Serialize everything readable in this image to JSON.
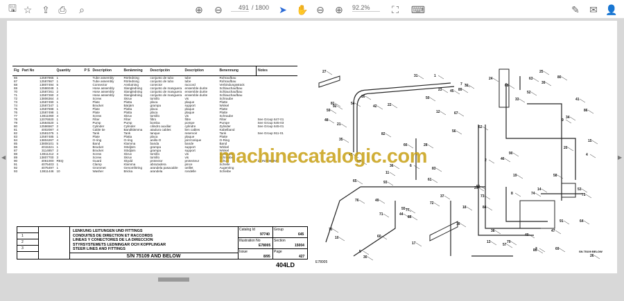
{
  "toolbar": {
    "page_current": "491",
    "page_total": "/ 1800",
    "zoom": "92.2%",
    "icons": [
      "save-icon",
      "bookmark-star-icon",
      "upload-icon",
      "print-icon",
      "search-icon",
      "page-up-icon",
      "page-down-icon",
      "select-cursor-icon",
      "hand-icon",
      "zoom-out-icon",
      "zoom-in-icon",
      "fit-page-icon",
      "read-mode-icon",
      "sign-icon",
      "mail-icon",
      "add-user-icon"
    ]
  },
  "colors": {
    "watermark": "#c8a014",
    "cursor": "#2a6ad6"
  },
  "table": {
    "headers": {
      "fig": "Fig",
      "part": "Part No",
      "qty": "Quantity",
      "q1": "1",
      "q2": "2",
      "q3": "3",
      "ps": "P S",
      "s": "S I",
      "desc": "Description",
      "sv": "Benämning",
      "es": "Descripción",
      "fr": "Description",
      "de": "Benennung",
      "notes": "Notes"
    },
    "rows": [
      [
        "65",
        "12587865",
        "1",
        "Tube assembly",
        "Rörledning",
        "conjunto de tubo",
        "tube",
        "Rohraufbau",
        ""
      ],
      [
        "67",
        "12587867",
        "1",
        "Tube assembly",
        "Rörledning",
        "conjunto de tubo",
        "tube",
        "Rohraufbau",
        ""
      ],
      [
        "68",
        "13807494",
        "5",
        "Connector",
        "Anslutning",
        "conector",
        "raccord",
        "Verbindungsstück",
        ""
      ],
      [
        "69",
        "12586048",
        "1",
        "Hose assembly",
        "Slangledning",
        "conjunto de manguera",
        "ensemble durite",
        "Schlauchaufbau",
        ""
      ],
      [
        "70",
        "12587261",
        "2",
        "Hose assembly",
        "Slangledning",
        "conjunto de manguera",
        "ensemble durite",
        "Schlauchaufbau",
        ""
      ],
      [
        "71",
        "12587260",
        "2",
        "Hose assembly",
        "Slangledning",
        "conjunto de manguera",
        "ensemble durite",
        "Schlauchaufbau",
        ""
      ],
      [
        "72",
        "13806364",
        "4",
        "Screw",
        "Skruv",
        "tornillo",
        "vis",
        "Schraube",
        ""
      ],
      [
        "73",
        "12587490",
        "1",
        "Plate",
        "Platta",
        "placa",
        "plaque",
        "Platte",
        ""
      ],
      [
        "74",
        "12587347",
        "1",
        "Bracket",
        "Bärjärn",
        "grampa",
        "support",
        "Winkel",
        ""
      ],
      [
        "75",
        "12587698",
        "1",
        "Plate",
        "Platta",
        "placa",
        "plaque",
        "Platte",
        ""
      ],
      [
        "76",
        "12587498",
        "1",
        "Plate",
        "Platta",
        "placa",
        "plaque",
        "Platte",
        ""
      ],
      [
        "77",
        "13811060",
        "4",
        "Screw",
        "Skruv",
        "tornillo",
        "vis",
        "Schraube",
        ""
      ],
      [
        "78",
        "12076920",
        "1",
        "Filter",
        "Filter",
        "filtro",
        "filtre",
        "Filter",
        "See Group 647-01"
      ],
      [
        "79",
        "12584520",
        "1",
        "Pump",
        "Pump",
        "bomba",
        "pompe",
        "Pumpe",
        "See Group 645-03"
      ],
      [
        "80",
        "12586567",
        "2",
        "Cylinder",
        "Cylinder",
        "cilindro auxiliar",
        "cylindre",
        "Zylinder",
        "See Group 645-01"
      ],
      [
        "81",
        "4002087",
        "4",
        "Cable tie",
        "Bandklämma",
        "atadura cables",
        "lien cables",
        "Kabelband",
        ""
      ],
      [
        "82",
        "12581075",
        "1",
        "Tank",
        "Tank",
        "tanque",
        "reservoir",
        "Tank",
        "See Group 911-01"
      ],
      [
        "83",
        "12587485",
        "1",
        "Plate",
        "Platta",
        "placa",
        "plaque",
        "Platte",
        ""
      ],
      [
        "84",
        "13804267",
        "4",
        "O-ring",
        "O-ring",
        "anillo-O",
        "joint torique",
        "O-Ring",
        ""
      ],
      [
        "85",
        "13808101",
        "5",
        "Band",
        "Klamma",
        "banda",
        "bande",
        "Band",
        ""
      ],
      [
        "86",
        "4015321",
        "1",
        "Bracket",
        "Stödjärn",
        "grampa",
        "support",
        "Winkel",
        ""
      ],
      [
        "87",
        "3114857",
        "2",
        "Bracket",
        "Stödjärn",
        "grampa",
        "support",
        "Winkel",
        ""
      ],
      [
        "88",
        "13811212",
        "3",
        "Screw",
        "Skruv",
        "tornillo",
        "vis",
        "Schraube",
        ""
      ],
      [
        "89",
        "13807700",
        "3",
        "Screw",
        "Skruv",
        "tornillo",
        "vis",
        "Schraube",
        ""
      ],
      [
        "90",
        "4061000",
        "REQ",
        "Guard",
        "Skydd",
        "protector",
        "protecteur",
        "Schutz",
        "12 IN/305MM"
      ],
      [
        "91",
        "4075403",
        "1",
        "Clamp",
        "Klamma",
        "abrazadera",
        "pince",
        "Schelle",
        ""
      ],
      [
        "92",
        "4075497",
        "1",
        "Grommet",
        "Genomföring",
        "arandela pasacable",
        "oeillet",
        "Augenring",
        ""
      ],
      [
        "93",
        "13811446",
        "10",
        "Washer",
        "Bricka",
        "arandela",
        "rondelle",
        "Scheibe",
        ""
      ]
    ]
  },
  "titleblock": {
    "rows": [
      "1",
      "2",
      "3"
    ],
    "titles": [
      "LENKUNG LEITUNGEN UND FITTINGS",
      "CONDUITES DE DIRECTION ET RACCORDS",
      "LINEAS Y CONECTORES DE LA DIRECCION",
      "STYRSYSTEMETS LEDNINGAR OCH KOPPLINGAR",
      "STEER LINES AND FITTINGS"
    ],
    "serial": "S/N 75109 AND BELOW",
    "catalog_label": "Catalog Id",
    "catalog": "97740",
    "group_label": "Group",
    "group": "645",
    "illus_label": "Illustration No",
    "illus": "E78005",
    "section_label": "Section",
    "section": "15004",
    "issue_label": "Issue",
    "issue": "8/95",
    "page_label": "Page",
    "page": "427",
    "model": "404LD"
  },
  "diagram": {
    "ref": "E78005",
    "note": "SN 75109 BELOW",
    "callouts": [
      "27",
      "42",
      "28",
      "29",
      "40",
      "41",
      "43",
      "44",
      "45",
      "46",
      "47",
      "48",
      "49",
      "50",
      "51",
      "52",
      "53",
      "54",
      "55",
      "56",
      "57",
      "58",
      "59",
      "60",
      "61",
      "62",
      "63",
      "64",
      "65",
      "66",
      "67",
      "68",
      "69",
      "70",
      "71",
      "72",
      "73",
      "74",
      "75",
      "76",
      "77",
      "78",
      "79",
      "80",
      "81",
      "82",
      "83",
      "84",
      "85",
      "86",
      "87",
      "88",
      "89",
      "90",
      "91",
      "92",
      "93",
      "1",
      "2",
      "3",
      "4",
      "5",
      "6",
      "7",
      "8",
      "9",
      "10",
      "11",
      "12",
      "13",
      "14",
      "15",
      "16",
      "17",
      "18",
      "19",
      "20",
      "21",
      "22",
      "23",
      "24",
      "25",
      "26",
      "30",
      "31",
      "32",
      "33",
      "34",
      "35",
      "36",
      "37",
      "38",
      "39"
    ]
  },
  "watermark": "machinecatalogic.com"
}
